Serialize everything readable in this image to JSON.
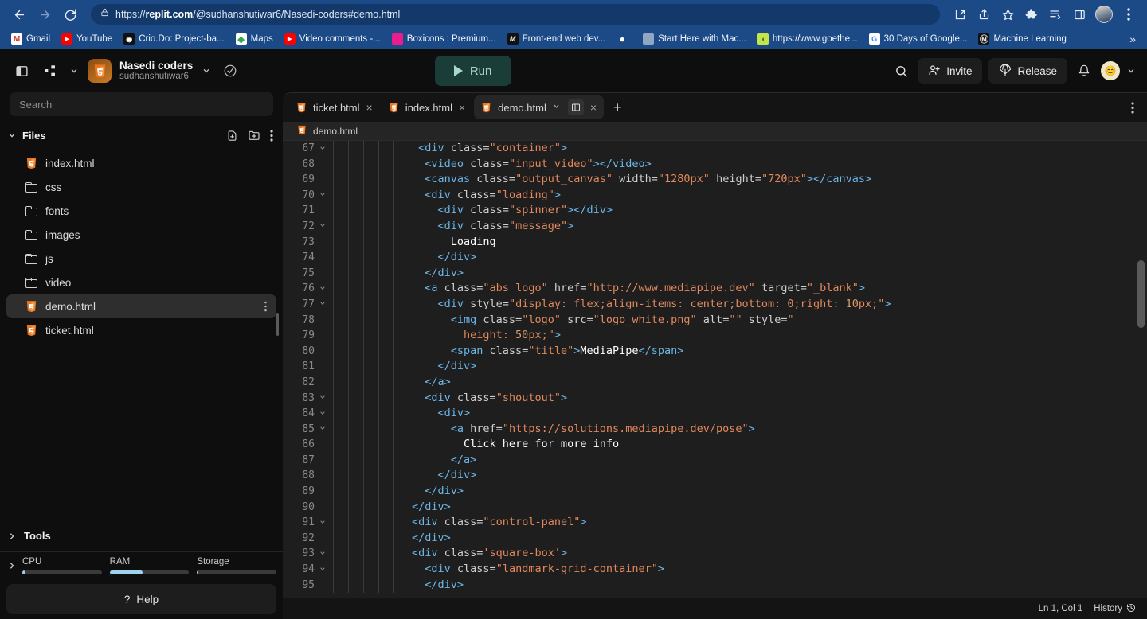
{
  "browser": {
    "url_prefix": "https://",
    "url_domain": "replit.com",
    "url_path": "/@sudhanshutiwar6/Nasedi-coders#demo.html",
    "back_icon": "back-arrow-icon",
    "forward_icon": "forward-arrow-icon",
    "reload_icon": "reload-icon",
    "lock_icon": "lock-icon",
    "install_icon": "install-app-icon",
    "share_icon": "share-icon",
    "bookmark_icon": "star-icon",
    "extensions_icon": "puzzle-extensions-icon",
    "reading_list_icon": "reading-list-icon",
    "sidepanel_icon": "side-panel-icon",
    "menu_icon": "three-dot-menu-icon",
    "bookmarks": [
      {
        "label": "Gmail",
        "icon": "gmail-icon",
        "glyph": "M"
      },
      {
        "label": "YouTube",
        "icon": "youtube-icon",
        "glyph": "▶"
      },
      {
        "label": "Crio.Do: Project-ba...",
        "icon": "crio-icon",
        "glyph": "◉"
      },
      {
        "label": "Maps",
        "icon": "google-maps-icon",
        "glyph": "◆"
      },
      {
        "label": "Video comments -...",
        "icon": "youtube-icon",
        "glyph": "▶"
      },
      {
        "label": "Boxicons : Premium...",
        "icon": "boxicons-icon",
        "glyph": ""
      },
      {
        "label": "Front-end web dev...",
        "icon": "mdn-icon",
        "glyph": "M"
      },
      {
        "label": "",
        "icon": "globe-icon",
        "glyph": "●"
      },
      {
        "label": "Start Here with Mac...",
        "icon": "machine-learning-icon",
        "glyph": ""
      },
      {
        "label": "https://www.goethe...",
        "icon": "goethe-icon",
        "glyph": "◖"
      },
      {
        "label": "30 Days of Google...",
        "icon": "google-icon",
        "glyph": "G"
      },
      {
        "label": "Machine Learning",
        "icon": "ml-icon",
        "glyph": "Ⓧ"
      }
    ],
    "overflow_label": "»"
  },
  "header": {
    "sidebar_toggle_icon": "panel-toggle-icon",
    "tree_icon": "repl-tree-icon",
    "tree_chevron_icon": "chevron-down-icon",
    "repl_icon": "html5-file-icon",
    "title": "Nasedi coders",
    "owner": "sudhanshutiwar6",
    "title_chevron_icon": "chevron-down-icon",
    "status_icon": "check-cloud-icon",
    "run_label": "Run",
    "run_icon": "play-icon",
    "search_icon": "search-icon",
    "invite_label": "Invite",
    "invite_icon": "person-add-icon",
    "release_label": "Release",
    "release_icon": "parachute-icon",
    "notifications_icon": "bell-icon",
    "avatar_icon": "user-avatar",
    "avatar_glyph": "😊",
    "avatar_chevron_icon": "chevron-down-icon"
  },
  "sidebar": {
    "search_placeholder": "Search",
    "files_label": "Files",
    "files_caret_icon": "chevron-down-icon",
    "new_file_icon": "new-file-icon",
    "new_folder_icon": "new-folder-icon",
    "files_menu_icon": "three-dot-menu-icon",
    "files": [
      {
        "name": "index.html",
        "type": "file",
        "selected": false
      },
      {
        "name": "css",
        "type": "folder",
        "selected": false
      },
      {
        "name": "fonts",
        "type": "folder",
        "selected": false
      },
      {
        "name": "images",
        "type": "folder",
        "selected": false
      },
      {
        "name": "js",
        "type": "folder",
        "selected": false
      },
      {
        "name": "video",
        "type": "folder",
        "selected": false
      },
      {
        "name": "demo.html",
        "type": "file",
        "selected": true
      },
      {
        "name": "ticket.html",
        "type": "file",
        "selected": false
      }
    ],
    "tools_label": "Tools",
    "tools_caret_icon": "chevron-right-icon",
    "resources_caret_icon": "chevron-right-icon",
    "meters": [
      {
        "label": "CPU",
        "percent": 3
      },
      {
        "label": "RAM",
        "percent": 41
      },
      {
        "label": "Storage",
        "percent": 2
      }
    ],
    "help_label": "Help",
    "help_icon": "question-mark-icon"
  },
  "editor": {
    "tabs": [
      {
        "label": "ticket.html",
        "icon": "html5-file-icon",
        "active": false,
        "has_chevron": false
      },
      {
        "label": "index.html",
        "icon": "html5-file-icon",
        "active": false,
        "has_chevron": false
      },
      {
        "label": "demo.html",
        "icon": "html5-file-icon",
        "active": true,
        "has_chevron": true
      }
    ],
    "tab_close_icon": "close-icon",
    "tab_chevron_icon": "chevron-down-icon",
    "tab_split_icon": "split-pane-icon",
    "tab_add_icon": "plus-icon",
    "tab_bar_menu_icon": "three-dot-menu-icon",
    "breadcrumb_icon": "html5-file-icon",
    "breadcrumb_label": "demo.html",
    "lines": [
      {
        "n": "67",
        "fold": true,
        "tokens": [
          {
            "t": "tag",
            "v": "                 <div "
          },
          {
            "t": "attr",
            "v": "class"
          },
          {
            "t": "eq",
            "v": "="
          },
          {
            "t": "str",
            "v": "\"container\""
          },
          {
            "t": "tag",
            "v": ">"
          }
        ]
      },
      {
        "n": "68",
        "fold": false,
        "tokens": [
          {
            "t": "tag",
            "v": "                  <video "
          },
          {
            "t": "attr",
            "v": "class"
          },
          {
            "t": "eq",
            "v": "="
          },
          {
            "t": "str",
            "v": "\"input_video\""
          },
          {
            "t": "tag",
            "v": "></video>"
          }
        ]
      },
      {
        "n": "69",
        "fold": false,
        "tokens": [
          {
            "t": "tag",
            "v": "                  <canvas "
          },
          {
            "t": "attr",
            "v": "class"
          },
          {
            "t": "eq",
            "v": "="
          },
          {
            "t": "str",
            "v": "\"output_canvas\""
          },
          {
            "t": "attr",
            "v": " width"
          },
          {
            "t": "eq",
            "v": "="
          },
          {
            "t": "str",
            "v": "\"1280px\""
          },
          {
            "t": "attr",
            "v": " height"
          },
          {
            "t": "eq",
            "v": "="
          },
          {
            "t": "str",
            "v": "\"720px\""
          },
          {
            "t": "tag",
            "v": "></canvas>"
          }
        ]
      },
      {
        "n": "70",
        "fold": true,
        "tokens": [
          {
            "t": "tag",
            "v": "                  <div "
          },
          {
            "t": "attr",
            "v": "class"
          },
          {
            "t": "eq",
            "v": "="
          },
          {
            "t": "str",
            "v": "\"loading\""
          },
          {
            "t": "tag",
            "v": ">"
          }
        ]
      },
      {
        "n": "71",
        "fold": false,
        "tokens": [
          {
            "t": "tag",
            "v": "                    <div "
          },
          {
            "t": "attr",
            "v": "class"
          },
          {
            "t": "eq",
            "v": "="
          },
          {
            "t": "str",
            "v": "\"spinner\""
          },
          {
            "t": "tag",
            "v": "></div>"
          }
        ]
      },
      {
        "n": "72",
        "fold": true,
        "tokens": [
          {
            "t": "tag",
            "v": "                    <div "
          },
          {
            "t": "attr",
            "v": "class"
          },
          {
            "t": "eq",
            "v": "="
          },
          {
            "t": "str",
            "v": "\"message\""
          },
          {
            "t": "tag",
            "v": ">"
          }
        ]
      },
      {
        "n": "73",
        "fold": false,
        "tokens": [
          {
            "t": "txt",
            "v": "                      Loading"
          }
        ]
      },
      {
        "n": "74",
        "fold": false,
        "tokens": [
          {
            "t": "tag",
            "v": "                    </div>"
          }
        ]
      },
      {
        "n": "75",
        "fold": false,
        "tokens": [
          {
            "t": "tag",
            "v": "                  </div>"
          }
        ]
      },
      {
        "n": "76",
        "fold": true,
        "tokens": [
          {
            "t": "tag",
            "v": "                  <a "
          },
          {
            "t": "attr",
            "v": "class"
          },
          {
            "t": "eq",
            "v": "="
          },
          {
            "t": "str",
            "v": "\"abs logo\""
          },
          {
            "t": "attr",
            "v": " href"
          },
          {
            "t": "eq",
            "v": "="
          },
          {
            "t": "str",
            "v": "\"http://www.mediapipe.dev\""
          },
          {
            "t": "attr",
            "v": " target"
          },
          {
            "t": "eq",
            "v": "="
          },
          {
            "t": "str",
            "v": "\"_blank\""
          },
          {
            "t": "tag",
            "v": ">"
          }
        ]
      },
      {
        "n": "77",
        "fold": true,
        "tokens": [
          {
            "t": "tag",
            "v": "                    <div "
          },
          {
            "t": "attr",
            "v": "style"
          },
          {
            "t": "eq",
            "v": "="
          },
          {
            "t": "str",
            "v": "\"display: flex;align-items: center;bottom: 0;right: "
          },
          {
            "t": "num",
            "v": "10"
          },
          {
            "t": "str",
            "v": "px;\""
          },
          {
            "t": "tag",
            "v": ">"
          }
        ]
      },
      {
        "n": "78",
        "fold": false,
        "tokens": [
          {
            "t": "tag",
            "v": "                      <img "
          },
          {
            "t": "attr",
            "v": "class"
          },
          {
            "t": "eq",
            "v": "="
          },
          {
            "t": "str",
            "v": "\"logo\""
          },
          {
            "t": "attr",
            "v": " src"
          },
          {
            "t": "eq",
            "v": "="
          },
          {
            "t": "str",
            "v": "\"logo_white.png\""
          },
          {
            "t": "attr",
            "v": " alt"
          },
          {
            "t": "eq",
            "v": "="
          },
          {
            "t": "str",
            "v": "\"\""
          },
          {
            "t": "attr",
            "v": " style"
          },
          {
            "t": "eq",
            "v": "="
          },
          {
            "t": "str",
            "v": "\""
          }
        ]
      },
      {
        "n": "79",
        "fold": false,
        "tokens": [
          {
            "t": "str",
            "v": "                        height: "
          },
          {
            "t": "num",
            "v": "50"
          },
          {
            "t": "str",
            "v": "px;\""
          },
          {
            "t": "tag",
            "v": ">"
          }
        ]
      },
      {
        "n": "80",
        "fold": false,
        "tokens": [
          {
            "t": "tag",
            "v": "                      <span "
          },
          {
            "t": "attr",
            "v": "class"
          },
          {
            "t": "eq",
            "v": "="
          },
          {
            "t": "str",
            "v": "\"title\""
          },
          {
            "t": "tag",
            "v": ">"
          },
          {
            "t": "txt",
            "v": "MediaPipe"
          },
          {
            "t": "tag",
            "v": "</span>"
          }
        ]
      },
      {
        "n": "81",
        "fold": false,
        "tokens": [
          {
            "t": "tag",
            "v": "                    </div>"
          }
        ]
      },
      {
        "n": "82",
        "fold": false,
        "tokens": [
          {
            "t": "tag",
            "v": "                  </a>"
          }
        ]
      },
      {
        "n": "83",
        "fold": true,
        "tokens": [
          {
            "t": "tag",
            "v": "                  <div "
          },
          {
            "t": "attr",
            "v": "class"
          },
          {
            "t": "eq",
            "v": "="
          },
          {
            "t": "str",
            "v": "\"shoutout\""
          },
          {
            "t": "tag",
            "v": ">"
          }
        ]
      },
      {
        "n": "84",
        "fold": true,
        "tokens": [
          {
            "t": "tag",
            "v": "                    <div>"
          }
        ]
      },
      {
        "n": "85",
        "fold": true,
        "tokens": [
          {
            "t": "tag",
            "v": "                      <a "
          },
          {
            "t": "attr",
            "v": "href"
          },
          {
            "t": "eq",
            "v": "="
          },
          {
            "t": "str",
            "v": "\"https://solutions.mediapipe.dev/pose\""
          },
          {
            "t": "tag",
            "v": ">"
          }
        ]
      },
      {
        "n": "86",
        "fold": false,
        "tokens": [
          {
            "t": "txt",
            "v": "                        Click here for more info"
          }
        ]
      },
      {
        "n": "87",
        "fold": false,
        "tokens": [
          {
            "t": "tag",
            "v": "                      </a>"
          }
        ]
      },
      {
        "n": "88",
        "fold": false,
        "tokens": [
          {
            "t": "tag",
            "v": "                    </div>"
          }
        ]
      },
      {
        "n": "89",
        "fold": false,
        "tokens": [
          {
            "t": "tag",
            "v": "                  </div>"
          }
        ]
      },
      {
        "n": "90",
        "fold": false,
        "tokens": [
          {
            "t": "tag",
            "v": "                </div>"
          }
        ]
      },
      {
        "n": "91",
        "fold": true,
        "tokens": [
          {
            "t": "tag",
            "v": "                <div "
          },
          {
            "t": "attr",
            "v": "class"
          },
          {
            "t": "eq",
            "v": "="
          },
          {
            "t": "str",
            "v": "\"control-panel\""
          },
          {
            "t": "tag",
            "v": ">"
          }
        ]
      },
      {
        "n": "92",
        "fold": false,
        "tokens": [
          {
            "t": "tag",
            "v": "                </div>"
          }
        ]
      },
      {
        "n": "93",
        "fold": true,
        "tokens": [
          {
            "t": "tag",
            "v": "                <div "
          },
          {
            "t": "attr",
            "v": "class"
          },
          {
            "t": "eq",
            "v": "="
          },
          {
            "t": "str",
            "v": "'square-box'"
          },
          {
            "t": "tag",
            "v": ">"
          }
        ]
      },
      {
        "n": "94",
        "fold": true,
        "tokens": [
          {
            "t": "tag",
            "v": "                  <div "
          },
          {
            "t": "attr",
            "v": "class"
          },
          {
            "t": "eq",
            "v": "="
          },
          {
            "t": "str",
            "v": "\"landmark-grid-container\""
          },
          {
            "t": "tag",
            "v": ">"
          }
        ]
      },
      {
        "n": "95",
        "fold": false,
        "tokens": [
          {
            "t": "tag",
            "v": "                  </div>"
          }
        ]
      }
    ]
  },
  "status_bar": {
    "cursor_position": "Ln 1, Col 1",
    "history_label": "History",
    "history_icon": "history-clock-icon"
  },
  "colors": {
    "browser_blue": "#1b4a87",
    "run_bg": "#1b3d38",
    "run_fg": "#a9d6ce",
    "meter_fill": "#9ed3ee",
    "html_orange": "#e8761f",
    "tag_blue": "#6cb6e8",
    "string_orange": "#e2885c"
  }
}
